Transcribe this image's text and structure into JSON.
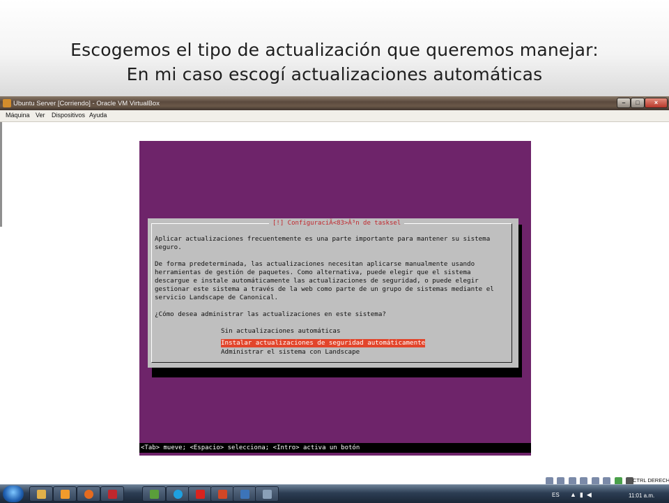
{
  "slide": {
    "title_line_1": "Escogemos el tipo de actualización que queremos manejar:",
    "title_line_2": "En mi caso escogí actualizaciones automáticas"
  },
  "window": {
    "title": "Ubuntu Server [Corriendo] - Oracle VM VirtualBox",
    "controls": {
      "minimize": "–",
      "maximize": "□",
      "close": "×"
    },
    "menu": [
      "Máquina",
      "Ver",
      "Dispositivos",
      "Ayuda"
    ]
  },
  "installer": {
    "dialog_title": "[!] ConfiguraciÃ<83>Â³n de tasksel",
    "paragraphs": [
      "Aplicar actualizaciones frecuentemente es una parte importante para mantener su sistema\nseguro.",
      "De forma predeterminada, las actualizaciones necesitan aplicarse manualmente usando\nherramientas de gestión de paquetes. Como alternativa, puede elegir que el sistema\ndescargue e instale automáticamente las actualizaciones de seguridad, o puede elegir\ngestionar este sistema a través de la web como parte de un grupo de sistemas mediante el\nservicio Landscape de Canonical.",
      "¿Cómo desea administrar las actualizaciones en este sistema?"
    ],
    "options": [
      "Sin actualizaciones automáticas",
      "Instalar actualizaciones de seguridad automáticamente",
      "Administrar el sistema con Landscape"
    ],
    "selected_option": "Instalar actualizaciones de seguridad automáticamente",
    "footer": "<Tab> mueve; <Espacio> selecciona; <Intro> activa un botón"
  },
  "vm_status": {
    "host_key_label": "CTRL DERECHA",
    "icons": [
      "hard-disk-icon",
      "optical-drive-icon",
      "usb-icon",
      "network-icon",
      "shared-folder-icon",
      "display-icon",
      "virtualization-icon",
      "mouse-integration-icon"
    ]
  },
  "taskbar": {
    "language": "ES",
    "clock": "11:01 a.m.",
    "apps": [
      {
        "name": "explorer",
        "color": "#e0b04a"
      },
      {
        "name": "media-player",
        "color": "#f29b2b"
      },
      {
        "name": "firefox",
        "color": "#e56b1f"
      },
      {
        "name": "flash",
        "color": "#c1272d"
      },
      {
        "name": "dreamweaver",
        "color": "#5a9e3a"
      },
      {
        "name": "skype",
        "color": "#1ea0e0"
      },
      {
        "name": "acrobat",
        "color": "#d8231e"
      },
      {
        "name": "powerpoint",
        "color": "#d24726"
      },
      {
        "name": "virtualbox",
        "color": "#3c74b9"
      },
      {
        "name": "tool",
        "color": "#8aa0b8"
      }
    ],
    "tray_icons": [
      "action-center-icon",
      "network-signal-icon",
      "volume-icon"
    ]
  }
}
